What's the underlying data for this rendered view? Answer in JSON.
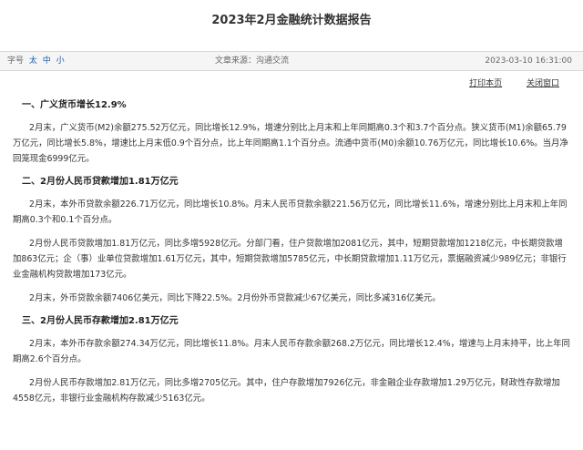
{
  "title": "2023年2月金融统计数据报告",
  "meta": {
    "font_label": "字号",
    "font_large": "太",
    "font_medium": "中",
    "font_small": "小",
    "source": "文章来源：沟通交流",
    "date": "2023-03-10 16:31:00"
  },
  "actions": {
    "print": "打印本页",
    "close": "关闭窗口"
  },
  "sections": [
    {
      "heading": "一、广义货币增长12.9%",
      "paragraphs": [
        "2月末，广义货币(M2)余额275.52万亿元，同比增长12.9%，增速分别比上月末和上年同期高0.3个和3.7个百分点。狭义货币(M1)余额65.79万亿元，同比增长5.8%，增速比上月末低0.9个百分点，比上年同期高1.1个百分点。流通中货币(M0)余额10.76万亿元，同比增长10.6%。当月净回笼现金6999亿元。"
      ]
    },
    {
      "heading": "二、2月份人民币贷款增加1.81万亿元",
      "paragraphs": [
        "2月末，本外币贷款余额226.71万亿元，同比增长10.8%。月末人民币贷款余额221.56万亿元，同比增长11.6%，增速分别比上月末和上年同期高0.3个和0.1个百分点。",
        "2月份人民币贷款增加1.81万亿元，同比多增5928亿元。分部门看，住户贷款增加2081亿元，其中，短期贷款增加1218亿元，中长期贷款增加863亿元；企（事）业单位贷款增加1.61万亿元，其中，短期贷款增加5785亿元，中长期贷款增加1.11万亿元，票据融资减少989亿元；非银行业金融机构贷款增加173亿元。",
        "2月末，外币贷款余额7406亿美元，同比下降22.5%。2月份外币贷款减少67亿美元，同比多减316亿美元。"
      ]
    },
    {
      "heading": "三、2月份人民币存款增加2.81万亿元",
      "paragraphs": [
        "2月末，本外币存款余额274.34万亿元，同比增长11.8%。月末人民币存款余额268.2万亿元，同比增长12.4%，增速与上月末持平，比上年同期高2.6个百分点。",
        "2月份人民币存款增加2.81万亿元，同比多增2705亿元。其中，住户存款增加7926亿元，非金融企业存款增加1.29万亿元，财政性存款增加4558亿元，非银行业金融机构存款减少5163亿元。"
      ]
    }
  ]
}
